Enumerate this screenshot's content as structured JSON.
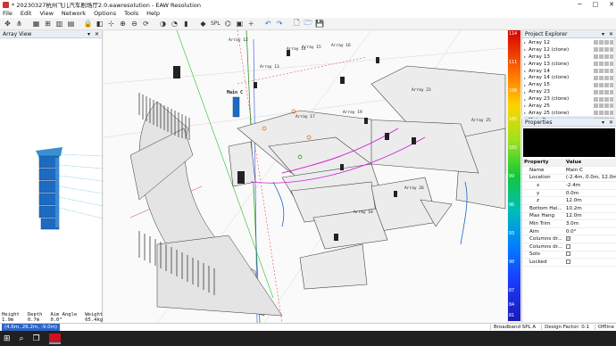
{
  "window": {
    "title": "* 20230327杭州飞儿汽车剧场厅2.0.eawresolution - EAW Resolution"
  },
  "menu": [
    "File",
    "Edit",
    "View",
    "Network",
    "Options",
    "Tools",
    "Help"
  ],
  "toolbar": {
    "spl_label": "SPL"
  },
  "array_view": {
    "title": "Array View",
    "stats": [
      {
        "label": "Height",
        "value": "1.9m"
      },
      {
        "label": "Depth",
        "value": "0.7m"
      },
      {
        "label": "Aim Angle",
        "value": "0.0°"
      },
      {
        "label": "Weight",
        "value": "65.4kg"
      }
    ]
  },
  "viewport": {
    "labels": [
      "Array 12",
      "Array 13",
      "Array 14",
      "Array 15",
      "Array 16",
      "Array 23",
      "Array 25",
      "Array 26",
      "Main C",
      "Array 17",
      "Array 18",
      "Array 19"
    ]
  },
  "colorbar": {
    "ticks": [
      "114",
      "111",
      "108",
      "105",
      "102",
      "99",
      "96",
      "93",
      "90",
      "87",
      "84",
      "81"
    ]
  },
  "explorer": {
    "title": "Project Explorer",
    "items": [
      "Array 12",
      "Array 12 (clone)",
      "Array 13",
      "Array 13 (clone)",
      "Array 14",
      "Array 14 (clone)",
      "Array 15",
      "Array 23",
      "Array 23 (clone)",
      "Array 25",
      "Array 25 (clone)",
      "Main C"
    ],
    "selected_index": 11
  },
  "properties": {
    "title": "Properties",
    "col_property": "Property",
    "col_value": "Value",
    "rows": [
      {
        "k": "Name",
        "v": "Main C"
      },
      {
        "k": "Location",
        "v": "(-2.4m, 0.0m, 12.0m)"
      },
      {
        "k": "x",
        "v": "-2.4m",
        "sub": true
      },
      {
        "k": "y",
        "v": "0.0m",
        "sub": true
      },
      {
        "k": "z",
        "v": "12.0m",
        "sub": true
      },
      {
        "k": "Bottom Hei...",
        "v": "10.2m"
      },
      {
        "k": "Max Hang",
        "v": "12.0m"
      },
      {
        "k": "Min Trim",
        "v": "3.0m"
      },
      {
        "k": "Aim",
        "v": "0.0°"
      },
      {
        "k": "Columns dr...",
        "v": "",
        "cb": true,
        "checked": true
      },
      {
        "k": "Columns dr...",
        "v": "",
        "cb": true,
        "checked": false
      },
      {
        "k": "Solo",
        "v": "",
        "cb": true,
        "checked": false
      },
      {
        "k": "Locked",
        "v": "",
        "cb": true,
        "checked": false
      }
    ]
  },
  "status": {
    "coords": "(4.6m, 26.2m, -9.0m)",
    "mode": "Broadband SPL A",
    "design_factor": "Design Factor: 0.1",
    "state": "Offline"
  }
}
